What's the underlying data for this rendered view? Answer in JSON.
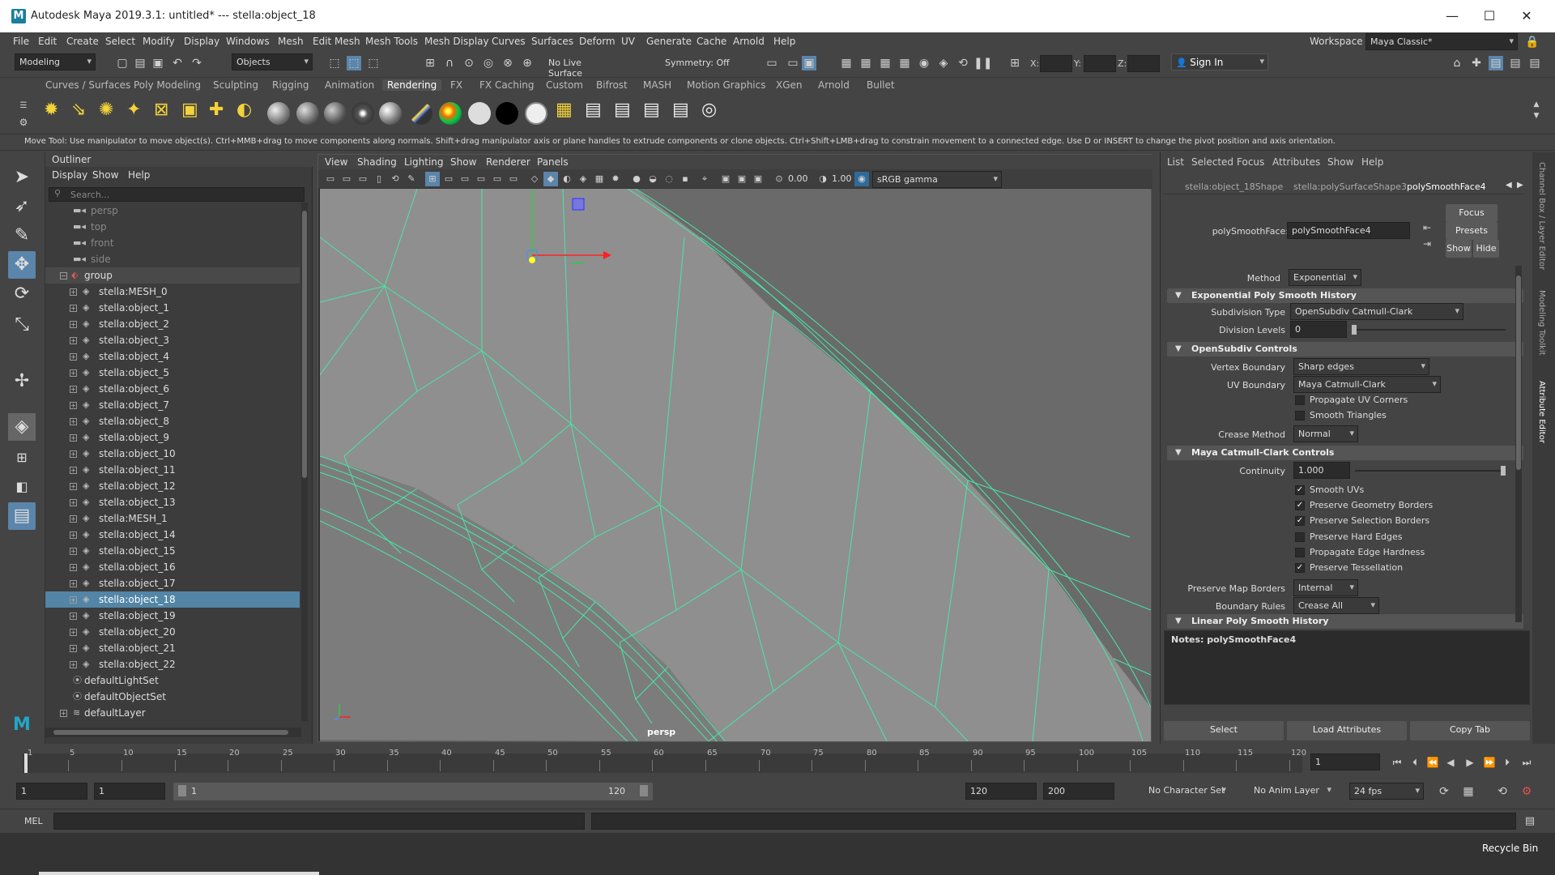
{
  "titlebar": {
    "title": "Autodesk Maya 2019.3.1: untitled*   ---   stella:object_18",
    "logo": "M"
  },
  "menu": [
    "File",
    "Edit",
    "Create",
    "Select",
    "Modify",
    "Display",
    "Windows",
    "Mesh",
    "Edit Mesh",
    "Mesh Tools",
    "Mesh Display",
    "Curves",
    "Surfaces",
    "Deform",
    "UV",
    "Generate",
    "Cache",
    "Arnold",
    "Help"
  ],
  "workspace": {
    "label": "Workspace :",
    "value": "Maya Classic*"
  },
  "status": {
    "mode": "Modeling",
    "objects": "Objects",
    "live": "No Live Surface",
    "symmetry": "Symmetry: Off",
    "x": "X:",
    "y": "Y:",
    "z": "Z:",
    "signin": "Sign In"
  },
  "shelf_tabs": [
    "Curves / Surfaces",
    "Poly Modeling",
    "Sculpting",
    "Rigging",
    "Animation",
    "Rendering",
    "FX",
    "FX Caching",
    "Custom",
    "Bifrost",
    "MASH",
    "Motion Graphics",
    "XGen",
    "Arnold",
    "Bullet"
  ],
  "help_line": "Move Tool: Use manipulator to move object(s). Ctrl+MMB+drag to move components along normals. Shift+drag manipulator axis or plane handles to extrude components or clone objects. Ctrl+Shift+LMB+drag to constrain movement to a connected edge. Use D or INSERT to change the pivot position and axis orientation.",
  "outliner": {
    "title": "Outliner",
    "menu": [
      "Display",
      "Show",
      "Help"
    ],
    "search_placeholder": "Search...",
    "items": [
      {
        "label": "persp",
        "type": "camera",
        "level": 0
      },
      {
        "label": "top",
        "type": "camera",
        "level": 0
      },
      {
        "label": "front",
        "type": "camera",
        "level": 0
      },
      {
        "label": "side",
        "type": "camera",
        "level": 0
      },
      {
        "label": "group",
        "type": "group",
        "level": 0
      },
      {
        "label": "stella:MESH_0",
        "type": "mesh",
        "level": 1
      },
      {
        "label": "stella:object_1",
        "type": "mesh",
        "level": 1
      },
      {
        "label": "stella:object_2",
        "type": "mesh",
        "level": 1
      },
      {
        "label": "stella:object_3",
        "type": "mesh",
        "level": 1
      },
      {
        "label": "stella:object_4",
        "type": "mesh",
        "level": 1
      },
      {
        "label": "stella:object_5",
        "type": "mesh",
        "level": 1
      },
      {
        "label": "stella:object_6",
        "type": "mesh",
        "level": 1
      },
      {
        "label": "stella:object_7",
        "type": "mesh",
        "level": 1
      },
      {
        "label": "stella:object_8",
        "type": "mesh",
        "level": 1
      },
      {
        "label": "stella:object_9",
        "type": "mesh",
        "level": 1
      },
      {
        "label": "stella:object_10",
        "type": "mesh",
        "level": 1
      },
      {
        "label": "stella:object_11",
        "type": "mesh",
        "level": 1
      },
      {
        "label": "stella:object_12",
        "type": "mesh",
        "level": 1
      },
      {
        "label": "stella:object_13",
        "type": "mesh",
        "level": 1
      },
      {
        "label": "stella:MESH_1",
        "type": "mesh",
        "level": 1
      },
      {
        "label": "stella:object_14",
        "type": "mesh",
        "level": 1
      },
      {
        "label": "stella:object_15",
        "type": "mesh",
        "level": 1
      },
      {
        "label": "stella:object_16",
        "type": "mesh",
        "level": 1
      },
      {
        "label": "stella:object_17",
        "type": "mesh",
        "level": 1
      },
      {
        "label": "stella:object_18",
        "type": "mesh",
        "level": 1,
        "selected": true
      },
      {
        "label": "stella:object_19",
        "type": "mesh",
        "level": 1
      },
      {
        "label": "stella:object_20",
        "type": "mesh",
        "level": 1
      },
      {
        "label": "stella:object_21",
        "type": "mesh",
        "level": 1
      },
      {
        "label": "stella:object_22",
        "type": "mesh",
        "level": 1
      },
      {
        "label": "defaultLightSet",
        "type": "set",
        "level": 0
      },
      {
        "label": "defaultObjectSet",
        "type": "set",
        "level": 0
      },
      {
        "label": "defaultLayer",
        "type": "layer",
        "level": 0
      }
    ]
  },
  "viewport": {
    "menu": [
      "View",
      "Shading",
      "Lighting",
      "Show",
      "Renderer",
      "Panels"
    ],
    "near": "0.00",
    "far": "1.00",
    "colorspace": "sRGB gamma",
    "camera_label": "persp"
  },
  "attribute_editor": {
    "menu": [
      "List",
      "Selected",
      "Focus",
      "Attributes",
      "Show",
      "Help"
    ],
    "tabs": [
      "stella:object_18Shape",
      "stella:polySurfaceShape3",
      "polySmoothFace4"
    ],
    "node_label": "polySmoothFace:",
    "node_value": "polySmoothFace4",
    "side_buttons": {
      "focus": "Focus",
      "presets": "Presets",
      "show": "Show",
      "hide": "Hide"
    },
    "method_label": "Method",
    "method_value": "Exponential",
    "sec_exp": "Exponential Poly Smooth History",
    "subdiv_type_label": "Subdivision Type",
    "subdiv_type_value": "OpenSubdiv Catmull-Clark",
    "division_levels_label": "Division Levels",
    "division_levels_value": "0",
    "sec_osd": "OpenSubdiv Controls",
    "vertex_boundary_label": "Vertex Boundary",
    "vertex_boundary_value": "Sharp edges",
    "uv_boundary_label": "UV Boundary",
    "uv_boundary_value": "Maya Catmull-Clark",
    "propagate_uv": "Propagate UV Corners",
    "smooth_triangles": "Smooth Triangles",
    "crease_method_label": "Crease Method",
    "crease_method_value": "Normal",
    "sec_maya": "Maya Catmull-Clark Controls",
    "continuity_label": "Continuity",
    "continuity_value": "1.000",
    "checks": [
      {
        "label": "Smooth UVs",
        "checked": true
      },
      {
        "label": "Preserve Geometry Borders",
        "checked": true
      },
      {
        "label": "Preserve Selection Borders",
        "checked": true
      },
      {
        "label": "Preserve Hard Edges",
        "checked": false
      },
      {
        "label": "Propagate Edge Hardness",
        "checked": false
      },
      {
        "label": "Preserve Tessellation",
        "checked": true
      }
    ],
    "preserve_map_label": "Preserve Map Borders",
    "preserve_map_value": "Internal",
    "boundary_rules_label": "Boundary Rules",
    "boundary_rules_value": "Crease All",
    "sec_linear": "Linear Poly Smooth History",
    "notes": "Notes:  polySmoothFace4",
    "buttons": [
      "Select",
      "Load Attributes",
      "Copy Tab"
    ]
  },
  "side_tabs": [
    "Channel Box / Layer Editor",
    "Modeling Toolkit",
    "Attribute Editor"
  ],
  "timeline": {
    "ticks": [
      "1",
      "5",
      "10",
      "15",
      "20",
      "25",
      "30",
      "35",
      "40",
      "45",
      "50",
      "55",
      "60",
      "65",
      "70",
      "75",
      "80",
      "85",
      "90",
      "95",
      "100",
      "105",
      "110",
      "115",
      "120"
    ],
    "current_frame": "1"
  },
  "range": {
    "start": "1",
    "anim_start": "1",
    "slider_start": "1",
    "slider_end": "120",
    "end": "120",
    "anim_end": "200",
    "char_set": "No Character Set",
    "anim_layer": "No Anim Layer",
    "fps": "24 fps"
  },
  "cmd": {
    "label": "MEL"
  },
  "taskbar": {
    "recycle": "Recycle Bin"
  },
  "colors": {
    "accent": "#5285a6",
    "wire": "#46e8a8",
    "panel": "#444444"
  }
}
